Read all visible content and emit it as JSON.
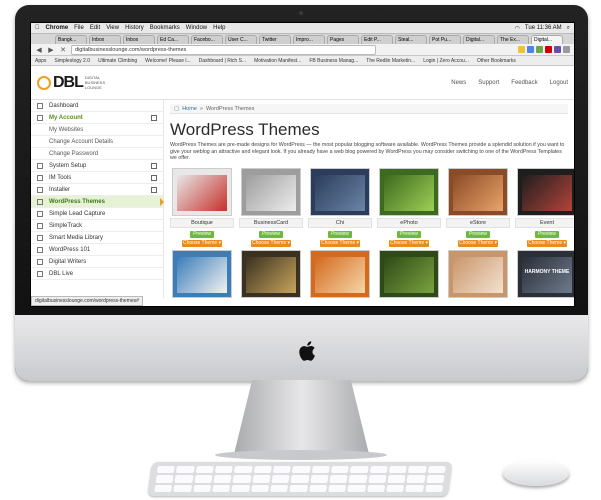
{
  "menubar": {
    "app": "Chrome",
    "items": [
      "File",
      "Edit",
      "View",
      "History",
      "Bookmarks",
      "Window",
      "Help"
    ],
    "clock": "Tue 11:36 AM"
  },
  "tabs": [
    {
      "label": "Bangk..."
    },
    {
      "label": "Inbox"
    },
    {
      "label": "Inbox"
    },
    {
      "label": "Ed Ca..."
    },
    {
      "label": "Facebo..."
    },
    {
      "label": "User C..."
    },
    {
      "label": "Twitter"
    },
    {
      "label": "Impro..."
    },
    {
      "label": "Pages"
    },
    {
      "label": "Edit P..."
    },
    {
      "label": "Steal..."
    },
    {
      "label": "Pot Pu..."
    },
    {
      "label": "Digital..."
    },
    {
      "label": "The Ex..."
    },
    {
      "label": "Digital...",
      "active": true
    }
  ],
  "address": {
    "url": "digitalbusinesslounge.com/wordpress-themes"
  },
  "bookmarks": [
    "Apps",
    "Simplestogy 2.0",
    "Ultimate Climbing",
    "Welcome! Please l...",
    "Dashboard | Rich S...",
    "Motivation Manifest...",
    "FB Business Manag...",
    "The Redlin Marketin...",
    "Login | Zero Accou...",
    "Other Bookmarks"
  ],
  "logo": {
    "mark": "DBL",
    "sub": "DIGITAL BUSINESS LOUNGE"
  },
  "site_nav": [
    "News",
    "Support",
    "Feedback",
    "Logout"
  ],
  "sidebar": [
    {
      "label": "Dashboard",
      "kind": "normal"
    },
    {
      "label": "My Account",
      "kind": "green",
      "toggle": true
    },
    {
      "label": "My Websites",
      "kind": "sub"
    },
    {
      "label": "Change Account Details",
      "kind": "sub"
    },
    {
      "label": "Change Password",
      "kind": "sub"
    },
    {
      "label": "System Setup",
      "kind": "normal",
      "toggle": true
    },
    {
      "label": "IM Tools",
      "kind": "normal",
      "toggle": true
    },
    {
      "label": "Installer",
      "kind": "normal",
      "toggle": true
    },
    {
      "label": "WordPress Themes",
      "kind": "active"
    },
    {
      "label": "Simple Lead Capture",
      "kind": "normal"
    },
    {
      "label": "SimpleTrack",
      "kind": "normal"
    },
    {
      "label": "Smart Media Library",
      "kind": "normal"
    },
    {
      "label": "WordPress 101",
      "kind": "normal"
    },
    {
      "label": "Digital Writers",
      "kind": "normal"
    },
    {
      "label": "DBL Live",
      "kind": "normal"
    }
  ],
  "breadcrumb": {
    "home": "Home",
    "sep": "»",
    "current": "WordPress Themes"
  },
  "page": {
    "title": "WordPress Themes",
    "intro": "WordPress Themes are pre-made designs for WordPress — the most popular blogging software available. WordPress Themes provide a splendid solution if you want to give your weblog an attractive and elegant look. If you already have a web blog powered by WordPress you may consider switching to one of the WordPress Templates we offer."
  },
  "buttons": {
    "preview": "Preview",
    "choose": "Choose Theme ▾"
  },
  "themes": [
    {
      "name": "Boutique",
      "colors": [
        "#e8e8e8",
        "#c5312b"
      ]
    },
    {
      "name": "BusinessCard",
      "colors": [
        "#9d9d9d",
        "#ededed"
      ]
    },
    {
      "name": "Chi",
      "colors": [
        "#2b3d5a",
        "#6c84a8"
      ]
    },
    {
      "name": "ePhoto",
      "colors": [
        "#3c6a1e",
        "#9fcf55"
      ]
    },
    {
      "name": "eStore",
      "colors": [
        "#8b4b26",
        "#e8a46a"
      ]
    },
    {
      "name": "Event",
      "colors": [
        "#1e1e1e",
        "#b3443a"
      ]
    },
    {
      "name": "",
      "colors": [
        "#3a7db8",
        "#f2f2f2"
      ]
    },
    {
      "name": "",
      "colors": [
        "#3b3120",
        "#c7a45d"
      ]
    },
    {
      "name": "",
      "colors": [
        "#d46a1e",
        "#f5d6a8"
      ]
    },
    {
      "name": "",
      "colors": [
        "#2e4a18",
        "#7aa23e"
      ]
    },
    {
      "name": "",
      "colors": [
        "#c9956b",
        "#f3e2cf"
      ]
    },
    {
      "name": "",
      "colors": [
        "#2a2f38",
        "#6e7a8c"
      ],
      "label": "HARMONY THEME"
    }
  ],
  "status_url": "digitalbusinesslounge.com/wordpress-themes#"
}
